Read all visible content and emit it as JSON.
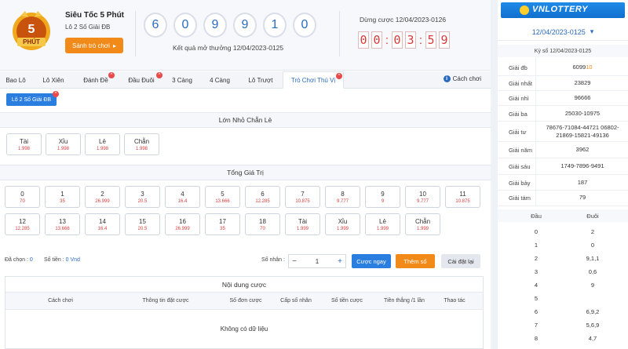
{
  "header": {
    "game_title": "Siêu Tốc 5 Phút",
    "game_subtitle": "Lô 2 Số Giải ĐB",
    "lobby_button": "Sảnh trò chơi",
    "logo_top": "5",
    "logo_bottom": "PHÚT",
    "balls": [
      "6",
      "0",
      "9",
      "9",
      "1",
      "0"
    ],
    "result_text": "Kết quả mở thưởng 12/04/2023-0125",
    "stop_text": "Dừng cược 12/04/2023-0126",
    "timer": [
      "0",
      "0",
      "0",
      "3",
      "5",
      "9"
    ]
  },
  "tabs": [
    {
      "label": "Bao Lô",
      "hot": false
    },
    {
      "label": "Lô Xiên",
      "hot": false
    },
    {
      "label": "Đánh Đề",
      "hot": true
    },
    {
      "label": "Đầu Đuôi",
      "hot": true
    },
    {
      "label": "3 Càng",
      "hot": false
    },
    {
      "label": "4 Càng",
      "hot": false
    },
    {
      "label": "Lô Trượt",
      "hot": false
    },
    {
      "label": "Trò Chơi Thú Vị",
      "hot": true,
      "active": true
    }
  ],
  "guide_label": "Cách chơi",
  "subtype_label": "Lô 2 Số Giải ĐB",
  "section1": {
    "title": "Lớn Nhỏ Chẵn Lẻ",
    "items": [
      {
        "name": "Tài",
        "odds": "1.998"
      },
      {
        "name": "Xỉu",
        "odds": "1.998"
      },
      {
        "name": "Lẻ",
        "odds": "1.998"
      },
      {
        "name": "Chẵn",
        "odds": "1.998"
      }
    ]
  },
  "section2": {
    "title": "Tổng Giá Trị",
    "row1": [
      {
        "name": "0",
        "odds": "70"
      },
      {
        "name": "1",
        "odds": "35"
      },
      {
        "name": "2",
        "odds": "26.999"
      },
      {
        "name": "3",
        "odds": "20.5"
      },
      {
        "name": "4",
        "odds": "16.4"
      },
      {
        "name": "5",
        "odds": "13.666"
      },
      {
        "name": "6",
        "odds": "12.285"
      },
      {
        "name": "7",
        "odds": "10.875"
      },
      {
        "name": "8",
        "odds": "9.777"
      },
      {
        "name": "9",
        "odds": "9"
      },
      {
        "name": "10",
        "odds": "9.777"
      },
      {
        "name": "11",
        "odds": "10.875"
      }
    ],
    "row2": [
      {
        "name": "12",
        "odds": "12.285"
      },
      {
        "name": "13",
        "odds": "13.666"
      },
      {
        "name": "14",
        "odds": "16.4"
      },
      {
        "name": "15",
        "odds": "20.5"
      },
      {
        "name": "16",
        "odds": "26.999"
      },
      {
        "name": "17",
        "odds": "35"
      },
      {
        "name": "18",
        "odds": "70"
      },
      {
        "name": "Tài",
        "odds": "1.999"
      },
      {
        "name": "Xỉu",
        "odds": "1.999"
      },
      {
        "name": "Lẻ",
        "odds": "1.999"
      },
      {
        "name": "Chẵn",
        "odds": "1.999"
      }
    ]
  },
  "betbar": {
    "selected_label": "Đã chọn :",
    "selected_value": "0",
    "amount_label": "Số tiền :",
    "amount_value": "0 Vnd",
    "multiplier_label": "Số nhân :",
    "minus": "−",
    "plus": "+",
    "multiplier_value": "1",
    "bet_now": "Cược ngay",
    "add_number": "Thêm số",
    "reset": "Cài đặt lại"
  },
  "content": {
    "title": "Nội dung cược",
    "columns": [
      "Cách chơi",
      "Thông tin đặt cược",
      "Số đơn cược",
      "Cấp số nhân",
      "Số tiền cược",
      "Tiền thắng /1 lần",
      "Thao tác"
    ],
    "empty": "Không có dữ liệu"
  },
  "side": {
    "brand": "VNLOTTERY",
    "draw_selected": "12/04/2023-0125",
    "draw_heading": "Kỳ số 12/04/2023-0125",
    "prizes": [
      {
        "label": "Giải đb",
        "value_main": "6099",
        "value_hl": "10"
      },
      {
        "label": "Giải nhất",
        "value": "23829"
      },
      {
        "label": "Giải nhì",
        "value": "96666"
      },
      {
        "label": "Giải ba",
        "value": "25030-10975"
      },
      {
        "label": "Giải tư",
        "value": "78676-71084-44721 06802-21869-15821-49136"
      },
      {
        "label": "Giải năm",
        "value": "3962"
      },
      {
        "label": "Giải sáu",
        "value": "1749-7896-9491"
      },
      {
        "label": "Giải bảy",
        "value": "187"
      },
      {
        "label": "Giải tám",
        "value": "79"
      }
    ],
    "head_col": "Đầu",
    "tail_col": "Đuôi",
    "head_tail": [
      {
        "head": "0",
        "tail": "2"
      },
      {
        "head": "1",
        "tail": "0"
      },
      {
        "head": "2",
        "tail": "9,1,1"
      },
      {
        "head": "3",
        "tail": "0,6"
      },
      {
        "head": "4",
        "tail": "9"
      },
      {
        "head": "5",
        "tail": ""
      },
      {
        "head": "6",
        "tail": "6,9,2"
      },
      {
        "head": "7",
        "tail": "5,6,9"
      },
      {
        "head": "8",
        "tail": "4,7"
      }
    ]
  }
}
